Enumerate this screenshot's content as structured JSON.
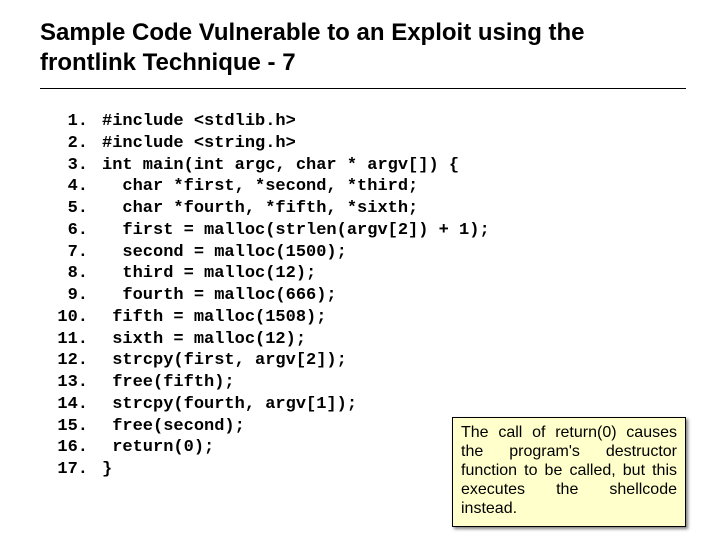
{
  "title": "Sample Code Vulnerable to an Exploit using the frontlink Technique - 7",
  "code": [
    {
      "n": "1.",
      "t": "#include <stdlib.h>"
    },
    {
      "n": "2.",
      "t": "#include <string.h>"
    },
    {
      "n": "3.",
      "t": "int main(int argc, char * argv[]) {"
    },
    {
      "n": "4.",
      "t": "  char *first, *second, *third;"
    },
    {
      "n": "5.",
      "t": "  char *fourth, *fifth, *sixth;"
    },
    {
      "n": "6.",
      "t": "  first = malloc(strlen(argv[2]) + 1);"
    },
    {
      "n": "7.",
      "t": "  second = malloc(1500);"
    },
    {
      "n": "8.",
      "t": "  third = malloc(12);"
    },
    {
      "n": "9.",
      "t": "  fourth = malloc(666);"
    },
    {
      "n": "10.",
      "t": " fifth = malloc(1508);"
    },
    {
      "n": "11.",
      "t": " sixth = malloc(12);"
    },
    {
      "n": "12.",
      "t": " strcpy(first, argv[2]);"
    },
    {
      "n": "13.",
      "t": " free(fifth);"
    },
    {
      "n": "14.",
      "t": " strcpy(fourth, argv[1]);"
    },
    {
      "n": "15.",
      "t": " free(second);"
    },
    {
      "n": "16.",
      "t": " return(0);"
    },
    {
      "n": "17.",
      "t": "}"
    }
  ],
  "callout": "The call of return(0) causes the program's destructor function to be called, but this executes the shellcode instead."
}
